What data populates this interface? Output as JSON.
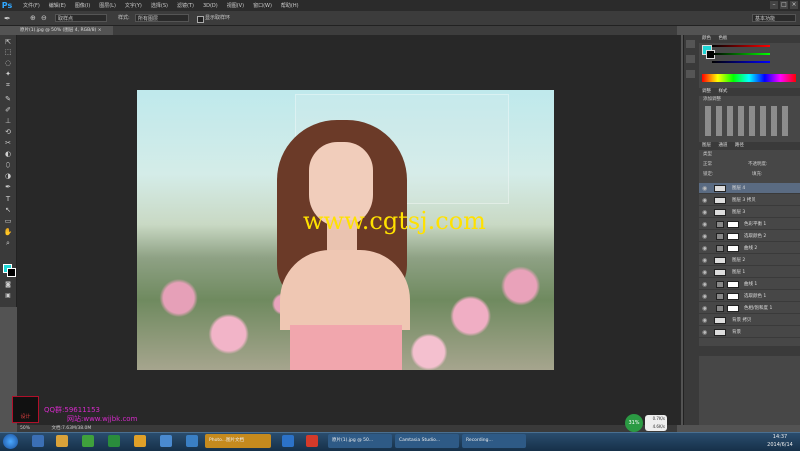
{
  "app": {
    "logo": "Ps",
    "menu": [
      "文件(F)",
      "编辑(E)",
      "图像(I)",
      "图层(L)",
      "文字(Y)",
      "选择(S)",
      "滤镜(T)",
      "3D(D)",
      "视图(V)",
      "窗口(W)",
      "帮助(H)"
    ],
    "window_buttons": [
      "–",
      "□",
      "×"
    ]
  },
  "options": {
    "sample_label": "取样点",
    "style_label": "样式:",
    "style_value": "所有图层",
    "show_ring": "显示取样环",
    "workspace": "基本功能"
  },
  "document": {
    "tab": "原片(1).jpg @ 50% (图层 4, RGB/8) ×",
    "watermark": "www.cgtsj.com"
  },
  "tools": [
    "⇱",
    "⬚",
    "◌",
    "✦",
    "⌗",
    "✎",
    "✐",
    "⊥",
    "⟲",
    "✂",
    "◐",
    "⬯",
    "◑",
    "✒",
    "T",
    "↖",
    "▭",
    "✋",
    "⌕"
  ],
  "panels": {
    "color_tab": "颜色",
    "swatch_tab": "色板",
    "adjust_tab": "调整",
    "style_tab": "样式",
    "adjust_title": "添加调整",
    "layers_tab": "图层",
    "channels_tab": "通道",
    "paths_tab": "路径",
    "kind_label": "类型",
    "blend_mode": "正常",
    "opacity_label": "不透明度:",
    "fill_label": "填充:",
    "lock_label": "锁定:",
    "foreground": "#1fd6d6",
    "background": "#000000"
  },
  "layers": [
    {
      "name": "图层 4",
      "type": "pixel",
      "selected": true
    },
    {
      "name": "图层 3 拷贝",
      "type": "pixel",
      "selected": false
    },
    {
      "name": "图层 3",
      "type": "pixel",
      "selected": false
    },
    {
      "name": "色彩平衡 1",
      "type": "adjust",
      "selected": false
    },
    {
      "name": "选取颜色 2",
      "type": "adjust",
      "selected": false
    },
    {
      "name": "曲线 2",
      "type": "adjust",
      "selected": false
    },
    {
      "name": "图层 2",
      "type": "pixel",
      "selected": false
    },
    {
      "name": "图层 1",
      "type": "pixel",
      "selected": false
    },
    {
      "name": "曲线 1",
      "type": "adjust",
      "selected": false
    },
    {
      "name": "选取颜色 1",
      "type": "adjust",
      "selected": false
    },
    {
      "name": "色相/饱和度 1",
      "type": "adjust",
      "selected": false
    },
    {
      "name": "背景 拷贝",
      "type": "pixel",
      "selected": false
    },
    {
      "name": "背景",
      "type": "pixel",
      "selected": false
    }
  ],
  "status": {
    "zoom": "50%",
    "doc": "文档:7.63M/38.0M"
  },
  "branding": {
    "qq": "QQ群:59611153",
    "site": "网站:www.wjjbk.com",
    "logo_text": "设计"
  },
  "system": {
    "cpu": "31%",
    "net_up": "0.7K/s",
    "net_down": "4.6K/s",
    "time": "14:37",
    "date": "2014/6/14"
  },
  "taskbar": [
    {
      "label": "Photo...图片文档",
      "color": "#c58a1e"
    },
    {
      "label": "原片(1).jpg @ 50...",
      "color": "#2e5a86"
    },
    {
      "label": "Camtasia Studio...",
      "color": "#2e5a86"
    },
    {
      "label": "Recording...",
      "color": "#2e5a86"
    }
  ]
}
